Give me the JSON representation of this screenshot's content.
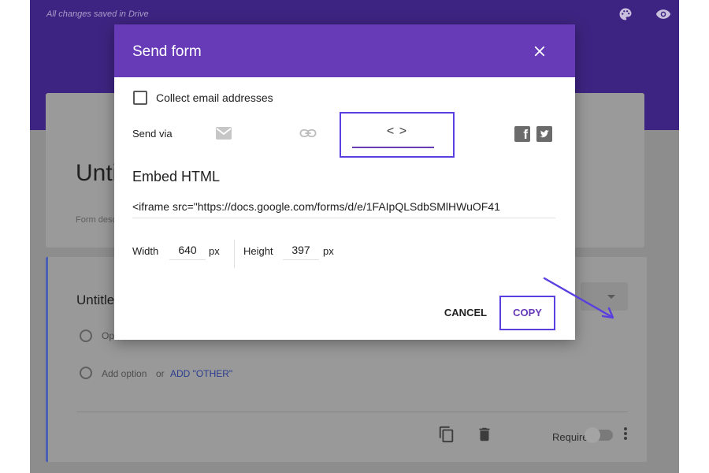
{
  "app": {
    "status": "All changes saved in Drive",
    "form_title": "Untitled form",
    "form_description": "Form description",
    "question_title": "Untitled Question",
    "option_1": "Option 1",
    "add_option": "Add option",
    "or_text": "or",
    "add_other": "ADD \"OTHER\"",
    "required_label": "Required"
  },
  "dialog": {
    "title": "Send form",
    "collect_email_label": "Collect email addresses",
    "collect_email_checked": false,
    "send_via_label": "Send via",
    "active_tab": "embed",
    "embed_icon_glyph": "< >",
    "embed_title": "Embed HTML",
    "embed_code": "<iframe src=\"https://docs.google.com/forms/d/e/1FAIpQLSdbSMlHWuOF41",
    "width_label": "Width",
    "width_value": "640",
    "width_unit": "px",
    "height_label": "Height",
    "height_value": "397",
    "height_unit": "px",
    "cancel_label": "CANCEL",
    "copy_label": "COPY"
  },
  "colors": {
    "dialog_header": "#673ab7",
    "highlight": "#5a3ee0",
    "app_header": "#3e2482",
    "overlay": "#8d8d8d"
  },
  "icons": [
    "palette-icon",
    "eye-icon",
    "close-icon",
    "email-icon",
    "link-icon",
    "embed-code-icon",
    "facebook-icon",
    "twitter-icon",
    "duplicate-icon",
    "trash-icon",
    "more-vert-icon"
  ]
}
